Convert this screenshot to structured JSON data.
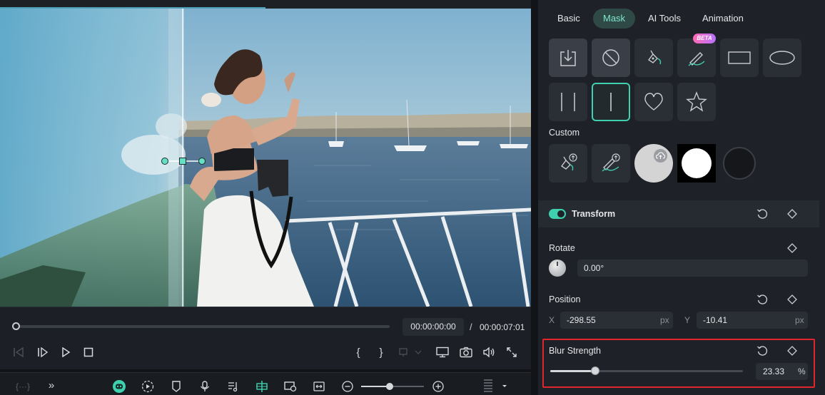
{
  "player": {
    "current_time": "00:00:00:00",
    "separator": "/",
    "total_time": "00:00:07:01",
    "progress": 0.0
  },
  "timeline_toolbar": {
    "marker_label": "{···}"
  },
  "panel": {
    "tabs": [
      {
        "label": "Basic",
        "active": false
      },
      {
        "label": "Mask",
        "active": true
      },
      {
        "label": "AI Tools",
        "active": false
      },
      {
        "label": "Animation",
        "active": false
      }
    ],
    "mask_shapes": [
      {
        "icon": "import-mask-icon",
        "selected": false
      },
      {
        "icon": "no-mask-icon",
        "selected": false
      },
      {
        "icon": "pen-mask-icon",
        "selected": false
      },
      {
        "icon": "brush-mask-icon",
        "selected": false,
        "badge": "BETA"
      },
      {
        "icon": "rectangle-mask-icon",
        "selected": false
      },
      {
        "icon": "ellipse-mask-icon",
        "selected": false
      },
      {
        "icon": "double-line-mask-icon",
        "selected": false
      },
      {
        "icon": "single-line-mask-icon",
        "selected": true
      },
      {
        "icon": "heart-mask-icon",
        "selected": false
      },
      {
        "icon": "star-mask-icon",
        "selected": false
      }
    ],
    "custom_label": "Custom",
    "transform": {
      "label": "Transform",
      "enabled": true
    },
    "rotate": {
      "label": "Rotate",
      "value": "0.00°"
    },
    "position": {
      "label": "Position",
      "x_label": "X",
      "x_value": "-298.55",
      "x_unit": "px",
      "y_label": "Y",
      "y_value": "-10.41",
      "y_unit": "px"
    },
    "blur": {
      "label": "Blur Strength",
      "value": "23.33",
      "unit": "%",
      "level": 0.2333
    }
  },
  "colors": {
    "accent": "#3fd0b0",
    "highlight_box": "#e0262c",
    "panel_bg": "#1e2127"
  }
}
